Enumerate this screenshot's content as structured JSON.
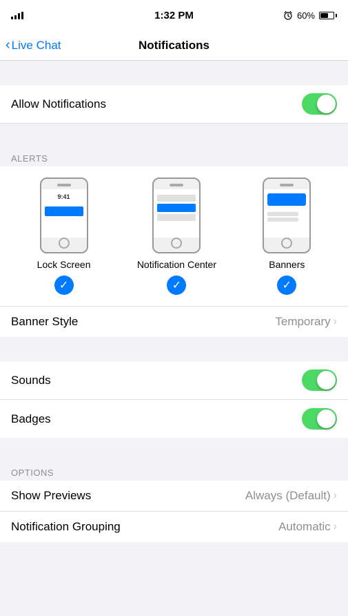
{
  "statusBar": {
    "time": "1:32 PM",
    "battery_percent": "60%",
    "alarm_visible": true
  },
  "navBar": {
    "back_label": "Live Chat",
    "title": "Notifications"
  },
  "allowNotifications": {
    "label": "Allow Notifications",
    "enabled": true
  },
  "alerts": {
    "section_label": "ALERTS",
    "options": [
      {
        "id": "lock-screen",
        "label": "Lock Screen",
        "time_text": "9:41",
        "checked": true
      },
      {
        "id": "notification-center",
        "label": "Notification Center",
        "checked": true
      },
      {
        "id": "banners",
        "label": "Banners",
        "checked": true
      }
    ]
  },
  "bannerStyle": {
    "label": "Banner Style",
    "value": "Temporary"
  },
  "sounds": {
    "label": "Sounds",
    "enabled": true
  },
  "badges": {
    "label": "Badges",
    "enabled": true
  },
  "options": {
    "section_label": "OPTIONS",
    "showPreviews": {
      "label": "Show Previews",
      "value": "Always (Default)"
    },
    "notificationGrouping": {
      "label": "Notification Grouping",
      "value": "Automatic"
    }
  }
}
